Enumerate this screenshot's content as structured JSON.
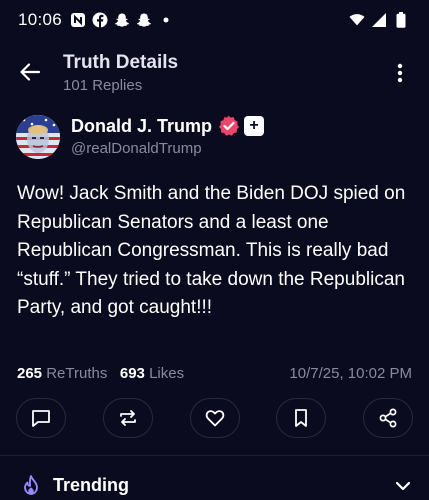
{
  "status_bar": {
    "time": "10:06",
    "left_icons": [
      "notification-n-icon",
      "facebook-icon",
      "snapchat-icon",
      "snapchat-icon",
      "dot-icon"
    ],
    "right_icons": [
      "wifi-icon",
      "signal-icon",
      "battery-icon"
    ]
  },
  "header": {
    "title": "Truth Details",
    "subtitle": "101 Replies"
  },
  "post": {
    "author_name": "Donald J. Trump",
    "author_handle": "@realDonaldTrump",
    "plus_badge": "+",
    "text": "Wow! Jack Smith and the Biden DOJ spied on Republican Senators and a least one Republican Congressman. This is really bad “stuff.” They tried to take down the Republican Party, and got caught!!!",
    "retruths_count": "265",
    "retruths_label": "ReTruths",
    "likes_count": "693",
    "likes_label": "Likes",
    "timestamp": "10/7/25, 10:02 PM"
  },
  "actions": [
    "reply-icon",
    "retruth-icon",
    "like-icon",
    "bookmark-icon",
    "share-icon"
  ],
  "trending": {
    "label": "Trending"
  },
  "colors": {
    "background": "#0b0b1f",
    "muted_text": "#8a8a9e",
    "verified_badge": "#e8466b",
    "trending_icon": "#9b8cff"
  }
}
